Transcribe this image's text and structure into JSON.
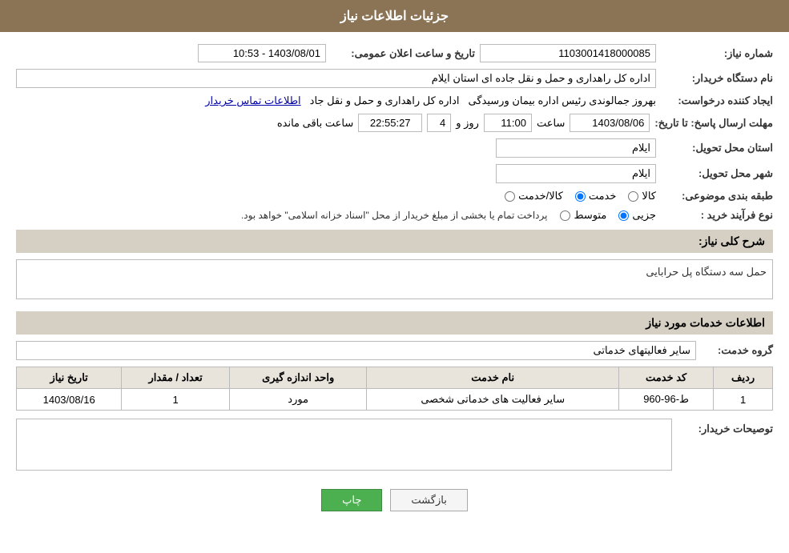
{
  "header": {
    "title": "جزئیات اطلاعات نیاز"
  },
  "fields": {
    "shomareNiaz_label": "شماره نیاز:",
    "shomareNiaz_value": "1103001418000085",
    "namDastgah_label": "نام دستگاه خریدار:",
    "namDastgah_value": "اداره کل راهداری و حمل و نقل جاده ای استان ایلام",
    "tarixSaatAelan_label": "تاریخ و ساعت اعلان عمومی:",
    "tarixSaatAelan_value": "1403/08/01 - 10:53",
    "ijadKanande_label": "ایجاد کننده درخواست:",
    "ijadKanande_name": "بهروز جمالوندی رئیس اداره بیمان ورسیدگی",
    "ijadKanande_org": "اداره کل راهداری و حمل و نقل جاد",
    "ijadKanande_link": "اطلاعات تماس خریدار",
    "mohlatErsalPasox_label": "مهلت ارسال پاسخ: تا تاریخ:",
    "mohlat_date": "1403/08/06",
    "mohlat_saat": "11:00",
    "mohlat_roz": "4",
    "mohlat_baghimande": "22:55:27",
    "saat_label": "ساعت",
    "roz_label": "روز و",
    "saat_baqi_label": "ساعت باقی مانده",
    "ostanMahal_label": "استان محل تحویل:",
    "ostanMahal_value": "ایلام",
    "shahrMahal_label": "شهر محل تحویل:",
    "shahrMahal_value": "ایلام",
    "tabaghe_label": "طبقه بندی موضوعی:",
    "tabaghe_kala": "کالا",
    "tabaghe_khedmat": "خدمت",
    "tabaghe_kalaKhedmat": "کالا/خدمت",
    "tabaghe_selected": "khedmat",
    "novFarayand_label": "نوع فرآیند خرید :",
    "novFarayand_jozei": "جزیی",
    "novFarayand_motavaset": "متوسط",
    "novFarayand_note": "پرداخت تمام یا بخشی از مبلغ خریدار از محل \"اسناد خزانه اسلامی\" خواهد بود.",
    "novFarayand_selected": "jozei",
    "sharhKoli_label": "شرح کلی نیاز:",
    "sharhKoli_value": "حمل سه دستگاه پل حرابایی",
    "khadamat_header": "اطلاعات خدمات مورد نیاز",
    "goroh_label": "گروه خدمت:",
    "goroh_value": "سایر فعالیتهای خدماتی",
    "table": {
      "headers": [
        "ردیف",
        "کد خدمت",
        "نام خدمت",
        "واحد اندازه گیری",
        "تعداد / مقدار",
        "تاریخ نیاز"
      ],
      "rows": [
        {
          "radif": "1",
          "kodKhedmat": "ط-96-960",
          "namKhedmat": "سایر فعالیت های خدماتی شخصی",
          "vahed": "مورد",
          "tedad": "1",
          "tarikh": "1403/08/16"
        }
      ]
    },
    "tosifKharidar_label": "توصیحات خریدار:",
    "tosif_value": ""
  },
  "buttons": {
    "print_label": "چاپ",
    "back_label": "بازگشت"
  }
}
